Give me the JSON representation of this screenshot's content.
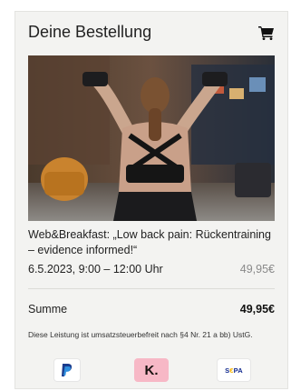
{
  "order": {
    "title": "Deine Bestellung"
  },
  "event": {
    "title": "Web&Breakfast: „Low back pain: Rückentraining – evidence informed!“",
    "date": "6.5.2023, 9:00 – 12:00 Uhr",
    "price": "49,95€"
  },
  "summary": {
    "label": "Summe",
    "value": "49,95€"
  },
  "tax_note": "Diese Leistung ist umsatzsteuerbefreit nach §4 Nr. 21 a bb) UstG.",
  "payment": {
    "klarna_label": "K.",
    "sepa_label_prefix": "S",
    "sepa_label_e": "€",
    "sepa_label_suffix": "PA"
  },
  "colors": {
    "card_background": "#f3f3f1",
    "paypal_blue": "#1565c0",
    "klarna_pink": "#f7b8c6",
    "sepa_blue": "#10298e",
    "sepa_yellow": "#f6b400"
  },
  "icons": [
    "cart-icon",
    "paypal-icon",
    "klarna-logo",
    "sepa-logo"
  ]
}
